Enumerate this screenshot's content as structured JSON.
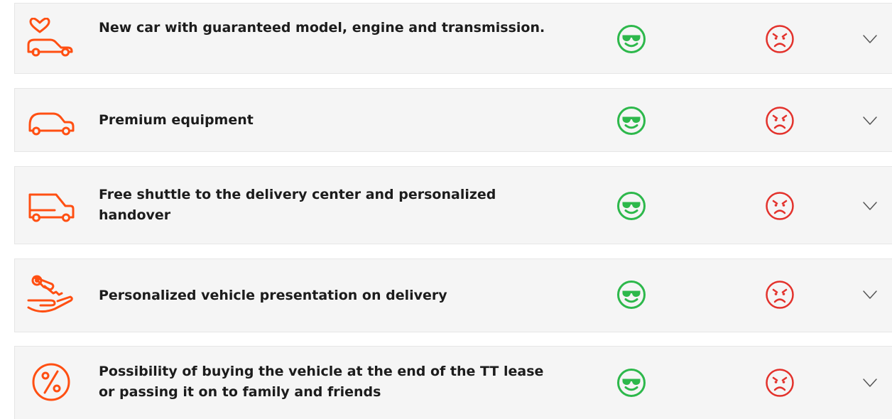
{
  "colors": {
    "accent_orange": "#ff4f12",
    "happy_green": "#2db84b",
    "angry_red": "#e3322c",
    "row_background": "#f5f5f5",
    "text": "#1c1c1c"
  },
  "rows": [
    {
      "icon": "car-heart-icon",
      "title": "New car with guaranteed model, engine and transmission."
    },
    {
      "icon": "car-icon",
      "title": "Premium equipment"
    },
    {
      "icon": "van-icon",
      "title": "Free shuttle to the delivery center and personalized handover"
    },
    {
      "icon": "key-hand-icon",
      "title": "Personalized vehicle presentation on delivery"
    },
    {
      "icon": "percent-icon",
      "title": "Possibility of buying the vehicle at the end of the TT lease or passing it on to family and friends"
    }
  ],
  "status_icons": {
    "positive": "cool-face-icon",
    "negative": "angry-face-icon",
    "expand": "chevron-down-icon"
  }
}
